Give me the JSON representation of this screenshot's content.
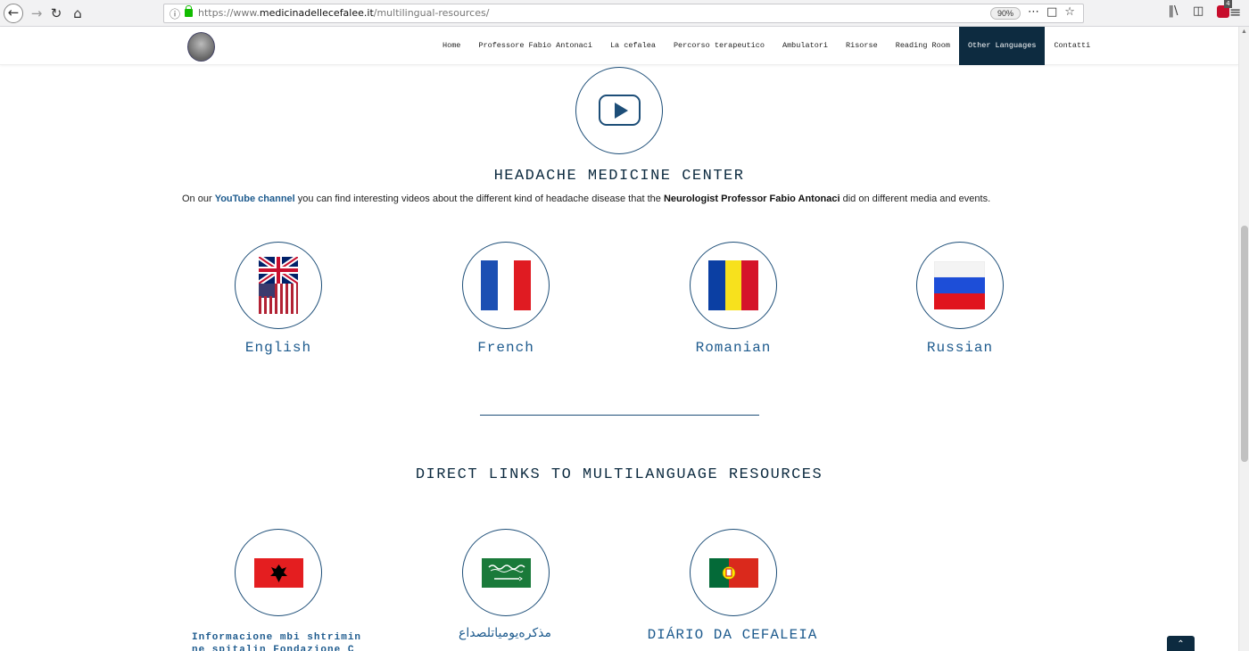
{
  "browser": {
    "url_prefix": "https://www.",
    "url_domain": "medicinadellecefalee.it",
    "url_path": "/multilingual-resources/",
    "zoom": "90%",
    "abp_count": "4"
  },
  "nav": {
    "items": [
      {
        "label": "Home"
      },
      {
        "label": "Professore Fabio Antonaci"
      },
      {
        "label": "La cefalea"
      },
      {
        "label": "Percorso terapeutico"
      },
      {
        "label": "Ambulatori"
      },
      {
        "label": "Risorse"
      },
      {
        "label": "Reading Room"
      },
      {
        "label": "Other Languages",
        "active": true
      },
      {
        "label": "Contatti"
      }
    ]
  },
  "hero": {
    "title": "HEADACHE MEDICINE CENTER",
    "intro_1": "On our ",
    "intro_link": "YouTube channel",
    "intro_2": " you can find interesting videos about the different kind of headache disease that the ",
    "intro_bold": "Neurologist Professor Fabio Antonaci",
    "intro_3": " did on different media and events."
  },
  "languages": [
    {
      "label": "English",
      "flag": "uk-us-flag"
    },
    {
      "label": "French",
      "flag": "france-flag"
    },
    {
      "label": "Romanian",
      "flag": "romania-flag"
    },
    {
      "label": "Russian",
      "flag": "russia-flag"
    }
  ],
  "resources": {
    "title": "DIRECT LINKS TO MULTILANGUAGE RESOURCES",
    "items": [
      {
        "label_line1": "Informacione mbi shtrimin",
        "label_line2": "ne spitalin Fondazione C",
        "flag": "albania-flag"
      },
      {
        "label_line1": "مذكرەيومياتلصداع",
        "flag": "saudi-flag"
      },
      {
        "label_line1": "DIÁRIO DA CEFALEIA",
        "flag": "portugal-flag"
      }
    ]
  },
  "colors": {
    "accent": "#1d4e78",
    "nav_active": "#0d2b40",
    "link": "#1e5b8e"
  }
}
